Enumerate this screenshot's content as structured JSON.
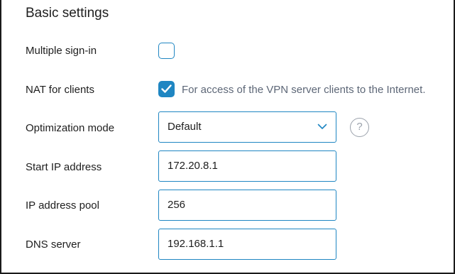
{
  "section": {
    "title": "Basic settings"
  },
  "settings": {
    "multiple_signin": {
      "label": "Multiple sign-in",
      "checked": false
    },
    "nat": {
      "label": "NAT for clients",
      "checked": true,
      "hint": "For access of the VPN server clients to the Internet."
    },
    "optimization": {
      "label": "Optimization mode",
      "value": "Default",
      "help_icon": "question-circle-icon",
      "help_glyph": "?"
    },
    "start_ip": {
      "label": "Start IP address",
      "value": "172.20.8.1"
    },
    "pool": {
      "label": "IP address pool",
      "value": "256"
    },
    "dns": {
      "label": "DNS server",
      "value": "192.168.1.1"
    }
  },
  "colors": {
    "accent": "#1f86c2",
    "hint_text": "#5d6777",
    "help_icon": "#9aa1ab"
  }
}
